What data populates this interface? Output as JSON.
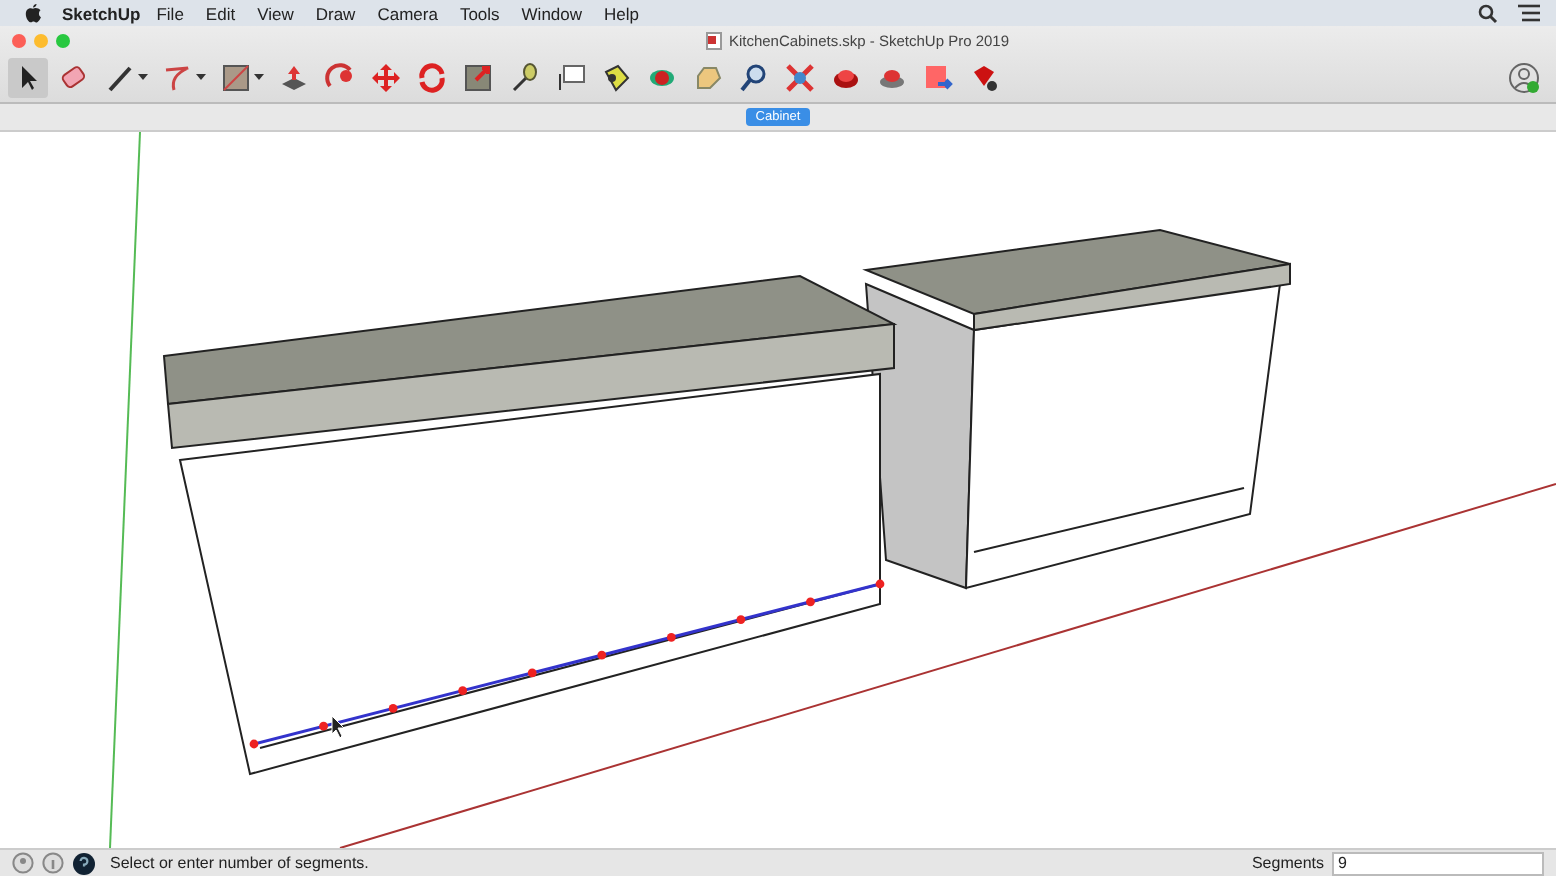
{
  "menu_bar": {
    "app_name": "SketchUp",
    "items": [
      "File",
      "Edit",
      "View",
      "Draw",
      "Camera",
      "Tools",
      "Window",
      "Help"
    ]
  },
  "window": {
    "title": "KitchenCabinets.skp - SketchUp Pro 2019"
  },
  "tabs": [
    {
      "label": "Cabinet",
      "selected": true
    }
  ],
  "status_bar": {
    "message": "Select or enter number of segments.",
    "measurement_label": "Segments",
    "measurement_value": "9"
  }
}
